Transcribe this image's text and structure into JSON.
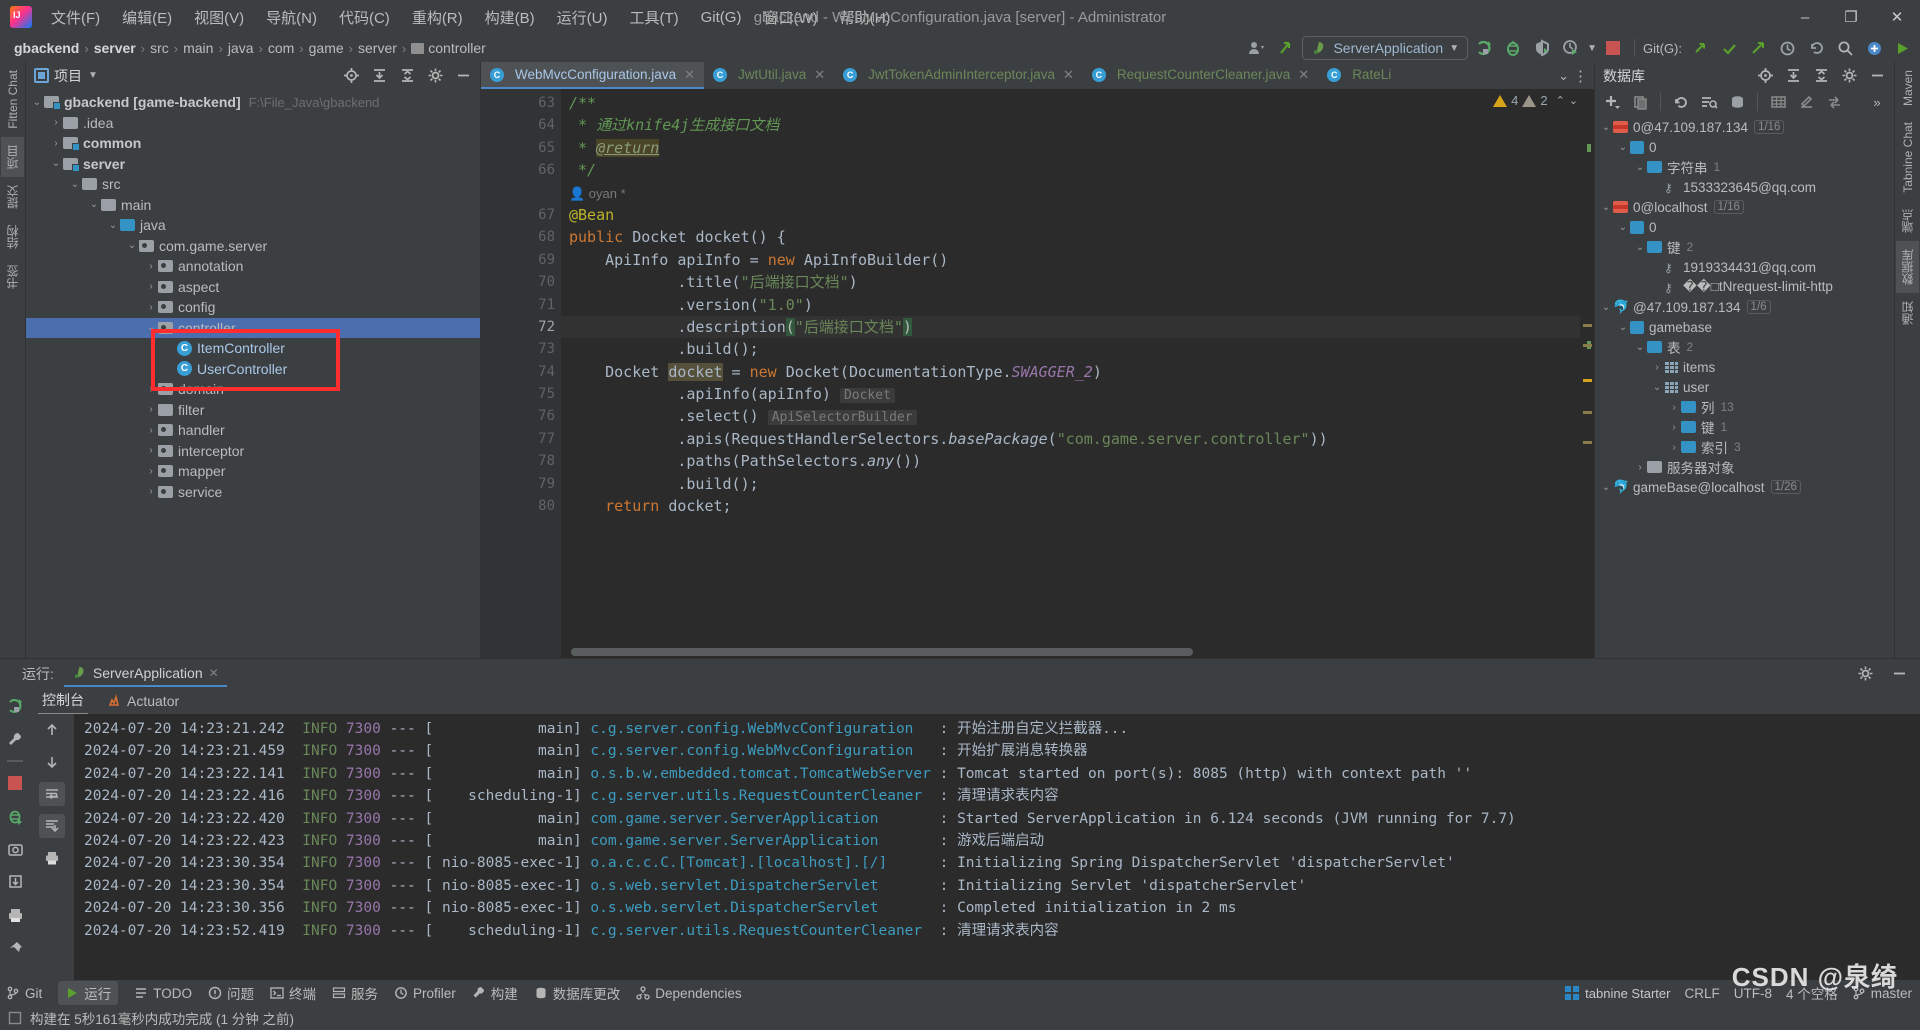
{
  "window": {
    "title": "gbackend - WebMvcConfiguration.java [server] - Administrator",
    "minimize": "–",
    "maximize": "❐",
    "close": "✕"
  },
  "menubar": {
    "items": [
      {
        "label": "文件(F)",
        "name": "menu-file"
      },
      {
        "label": "编辑(E)",
        "name": "menu-edit"
      },
      {
        "label": "视图(V)",
        "name": "menu-view"
      },
      {
        "label": "导航(N)",
        "name": "menu-navigate"
      },
      {
        "label": "代码(C)",
        "name": "menu-code"
      },
      {
        "label": "重构(R)",
        "name": "menu-refactor"
      },
      {
        "label": "构建(B)",
        "name": "menu-build"
      },
      {
        "label": "运行(U)",
        "name": "menu-run"
      },
      {
        "label": "工具(T)",
        "name": "menu-tools"
      },
      {
        "label": "Git(G)",
        "name": "menu-git"
      },
      {
        "label": "窗口(W)",
        "name": "menu-window"
      },
      {
        "label": "帮助(H)",
        "name": "menu-help"
      }
    ]
  },
  "navbar": {
    "breadcrumbs": [
      {
        "label": "gbackend",
        "bold": true
      },
      {
        "label": "server",
        "bold": true
      },
      {
        "label": "src",
        "bold": false
      },
      {
        "label": "main",
        "bold": false
      },
      {
        "label": "java",
        "bold": false
      },
      {
        "label": "com",
        "bold": false
      },
      {
        "label": "game",
        "bold": false
      },
      {
        "label": "server",
        "bold": false
      },
      {
        "label": "controller",
        "bold": false,
        "icon": "folder-icon"
      }
    ],
    "run_config": "ServerApplication",
    "git_label": "Git(G):",
    "icons": {
      "profile": "profile-icon",
      "update": "update-project-icon",
      "run": "run-icon",
      "debug": "debug-icon",
      "coverage": "run-with-coverage-icon",
      "profiler": "profiler-icon",
      "stop": "stop-icon",
      "commit": "commit-icon",
      "push": "push-icon",
      "update_git": "update-icon",
      "history": "history-icon",
      "rollback": "rollback-icon",
      "search": "search-icon",
      "plugin": "plugin-icon",
      "settings": "settings-icon"
    }
  },
  "project_panel": {
    "title": "项目",
    "header_icons": [
      "locate-icon",
      "expand-all-icon",
      "collapse-all-icon",
      "gear-icon",
      "hide-icon"
    ],
    "tree": [
      {
        "label": "gbackend [game-backend]",
        "suffix": "F:\\File_Java\\gbackend",
        "depth": 0,
        "arrow": "v",
        "icon": "module-folder",
        "bold": true
      },
      {
        "label": ".idea",
        "depth": 1,
        "arrow": ">",
        "icon": "folder",
        "bold": false
      },
      {
        "label": "common",
        "depth": 1,
        "arrow": ">",
        "icon": "module-folder",
        "bold": true
      },
      {
        "label": "server",
        "depth": 1,
        "arrow": "v",
        "icon": "module-folder",
        "bold": true
      },
      {
        "label": "src",
        "depth": 2,
        "arrow": "v",
        "icon": "folder",
        "bold": false
      },
      {
        "label": "main",
        "depth": 3,
        "arrow": "v",
        "icon": "folder",
        "bold": false
      },
      {
        "label": "java",
        "depth": 4,
        "arrow": "v",
        "icon": "source-folder",
        "bold": false
      },
      {
        "label": "com.game.server",
        "depth": 5,
        "arrow": "v",
        "icon": "package",
        "bold": false
      },
      {
        "label": "annotation",
        "depth": 6,
        "arrow": ">",
        "icon": "package",
        "bold": false
      },
      {
        "label": "aspect",
        "depth": 6,
        "arrow": ">",
        "icon": "package",
        "bold": false
      },
      {
        "label": "config",
        "depth": 6,
        "arrow": ">",
        "icon": "package",
        "bold": false
      },
      {
        "label": "controller",
        "depth": 6,
        "arrow": "v",
        "icon": "package",
        "bold": false,
        "selected": true
      },
      {
        "label": "ItemController",
        "depth": 7,
        "arrow": "",
        "icon": "class",
        "bold": false
      },
      {
        "label": "UserController",
        "depth": 7,
        "arrow": "",
        "icon": "class",
        "bold": false
      },
      {
        "label": "domain",
        "depth": 6,
        "arrow": ">",
        "icon": "package",
        "bold": false
      },
      {
        "label": "filter",
        "depth": 6,
        "arrow": ">",
        "icon": "folder",
        "bold": false
      },
      {
        "label": "handler",
        "depth": 6,
        "arrow": ">",
        "icon": "package",
        "bold": false
      },
      {
        "label": "interceptor",
        "depth": 6,
        "arrow": ">",
        "icon": "package",
        "bold": false
      },
      {
        "label": "mapper",
        "depth": 6,
        "arrow": ">",
        "icon": "package",
        "bold": false
      },
      {
        "label": "service",
        "depth": 6,
        "arrow": ">",
        "icon": "package",
        "bold": false
      }
    ]
  },
  "editor": {
    "tabs": [
      {
        "label": "WebMvcConfiguration.java",
        "active": true,
        "closable": true
      },
      {
        "label": "JwtUtil.java",
        "active": false,
        "closable": true
      },
      {
        "label": "JwtTokenAdminInterceptor.java",
        "active": false,
        "closable": true
      },
      {
        "label": "RequestCounterCleaner.java",
        "active": false,
        "closable": true
      },
      {
        "label": "RateLi",
        "active": false,
        "closable": false
      }
    ],
    "inspection": {
      "warnings": "4",
      "weak_warnings": "2"
    },
    "lines": [
      {
        "num": "63",
        "fold": "start"
      },
      {
        "num": "64"
      },
      {
        "num": "65"
      },
      {
        "num": "66",
        "fold": "end"
      },
      {
        "num": ""
      },
      {
        "num": "67",
        "gutter_icons": "bean-icon"
      },
      {
        "num": "68",
        "fold": "start"
      },
      {
        "num": "69"
      },
      {
        "num": "70"
      },
      {
        "num": "71"
      },
      {
        "num": "72",
        "current": true,
        "bulb": true
      },
      {
        "num": "73"
      },
      {
        "num": "74"
      },
      {
        "num": "75"
      },
      {
        "num": "76"
      },
      {
        "num": "77"
      },
      {
        "num": "78"
      },
      {
        "num": "79"
      },
      {
        "num": "80"
      }
    ],
    "author_hint": "oyan *",
    "inlay_hints": [
      "Docket",
      "ApiSelectorBuilder"
    ],
    "code_text": {
      "l63": "/**",
      "l64": " * 通过knife4j生成接口文档",
      "l65_pre": " * ",
      "l65_tag": "@return",
      "l67": "@Bean",
      "l68": "public Docket docket() {",
      "l69": "    ApiInfo apiInfo = new ApiInfoBuilder()",
      "l70": "            .title(\"后端接口文档\")",
      "l71": "            .version(\"1.0\")",
      "l72": "            .description(\"后端接口文档\")",
      "l73": "            .build();",
      "l74": "    Docket docket = new Docket(DocumentationType.SWAGGER_2)",
      "l75": "            .apiInfo(apiInfo)",
      "l76": "            .select()",
      "l77": "            .apis(RequestHandlerSelectors.basePackage(\"com.game.server.controller\"))",
      "l78": "            .paths(PathSelectors.any())",
      "l79": "            .build();",
      "l80": "    return docket;"
    }
  },
  "db_panel": {
    "title": "数据库",
    "header_icons": [
      "locate-icon",
      "expand-all-icon",
      "collapse-all-icon",
      "gear-icon",
      "hide-icon"
    ],
    "toolbar_icons": [
      "add-icon",
      "copy-icon",
      "refresh-icon",
      "run-query-icon",
      "db-icon",
      "table-icon",
      "edit-icon",
      "sync-icon",
      "more-icon"
    ],
    "tree": [
      {
        "label": "0@47.109.187.134",
        "badge": "1/16",
        "depth": 0,
        "arrow": "v",
        "icon": "redis"
      },
      {
        "label": "0",
        "depth": 1,
        "arrow": "v",
        "icon": "db"
      },
      {
        "label": "字符串",
        "count": "1",
        "depth": 2,
        "arrow": "v",
        "icon": "folder"
      },
      {
        "label": "1533323645@qq.com",
        "depth": 3,
        "arrow": "",
        "icon": "key-list"
      },
      {
        "label": "0@localhost",
        "badge": "1/16",
        "depth": 0,
        "arrow": "v",
        "icon": "redis"
      },
      {
        "label": "0",
        "depth": 1,
        "arrow": "v",
        "icon": "db"
      },
      {
        "label": "键",
        "count": "2",
        "depth": 2,
        "arrow": "v",
        "icon": "folder"
      },
      {
        "label": "1919334431@qq.com",
        "depth": 3,
        "arrow": "",
        "icon": "key"
      },
      {
        "label": "��□tNrequest-limit-http",
        "depth": 3,
        "arrow": "",
        "icon": "key"
      },
      {
        "label": "@47.109.187.134",
        "badge": "1/6",
        "depth": 0,
        "arrow": "v",
        "icon": "mysql"
      },
      {
        "label": "gamebase",
        "depth": 1,
        "arrow": "v",
        "icon": "schema"
      },
      {
        "label": "表",
        "count": "2",
        "depth": 2,
        "arrow": "v",
        "icon": "folder"
      },
      {
        "label": "items",
        "depth": 3,
        "arrow": ">",
        "icon": "table"
      },
      {
        "label": "user",
        "depth": 3,
        "arrow": "v",
        "icon": "table"
      },
      {
        "label": "列",
        "count": "13",
        "depth": 4,
        "arrow": ">",
        "icon": "folder"
      },
      {
        "label": "键",
        "count": "1",
        "depth": 4,
        "arrow": ">",
        "icon": "folder"
      },
      {
        "label": "索引",
        "count": "3",
        "depth": 4,
        "arrow": ">",
        "icon": "folder"
      },
      {
        "label": "服务器对象",
        "depth": 2,
        "arrow": ">",
        "icon": "server-objects"
      },
      {
        "label": "gameBase@localhost",
        "badge": "1/26",
        "depth": 0,
        "arrow": "v",
        "icon": "mysql"
      }
    ]
  },
  "right_tool_tabs": [
    {
      "label": "Maven",
      "name": "tool-tab-maven",
      "active": false
    },
    {
      "label": "Tabnine Chat",
      "name": "tool-tab-tabnine-chat",
      "active": false
    },
    {
      "label": "端点",
      "name": "tool-tab-endpoints",
      "active": false
    },
    {
      "label": "数据库",
      "name": "tool-tab-database",
      "active": true
    },
    {
      "label": "通知",
      "name": "tool-tab-notifications",
      "active": false
    }
  ],
  "left_tool_tabs": [
    {
      "label": "Fitten Chat",
      "name": "tool-tab-fitten-chat",
      "active": false
    },
    {
      "label": "项目",
      "name": "tool-tab-project",
      "active": true
    },
    {
      "label": "提交",
      "name": "tool-tab-commit",
      "active": false
    },
    {
      "label": "结构",
      "name": "tool-tab-structure",
      "active": false
    },
    {
      "label": "书签",
      "name": "tool-tab-bookmarks",
      "active": false
    }
  ],
  "run_panel": {
    "label": "运行:",
    "tab": "ServerApplication",
    "subtabs": [
      {
        "label": "控制台",
        "active": true
      },
      {
        "label": "Actuator",
        "active": false
      }
    ],
    "side_icons": [
      "rerun-icon",
      "wrench-icon",
      "stop-icon",
      "debug-icon",
      "camera-icon",
      "export-icon",
      "print-icon",
      "pin-icon"
    ],
    "nav_icons": [
      "scroll-up-icon",
      "scroll-down-icon",
      "soft-wrap-icon",
      "scroll-to-end-icon",
      "print-icon"
    ],
    "header_icons": [
      "settings-icon",
      "hide-icon"
    ],
    "logs": [
      {
        "date": "2024-07-20 14:23:21.242",
        "level": "INFO",
        "pid": "7300",
        "thread": "main",
        "cls": "c.g.server.config.WebMvcConfiguration",
        "msg": "开始注册自定义拦截器..."
      },
      {
        "date": "2024-07-20 14:23:21.459",
        "level": "INFO",
        "pid": "7300",
        "thread": "main",
        "cls": "c.g.server.config.WebMvcConfiguration",
        "msg": "开始扩展消息转换器"
      },
      {
        "date": "2024-07-20 14:23:22.141",
        "level": "INFO",
        "pid": "7300",
        "thread": "main",
        "cls": "o.s.b.w.embedded.tomcat.TomcatWebServer",
        "msg": "Tomcat started on port(s): 8085 (http) with context path ''"
      },
      {
        "date": "2024-07-20 14:23:22.416",
        "level": "INFO",
        "pid": "7300",
        "thread": "scheduling-1",
        "cls": "c.g.server.utils.RequestCounterCleaner",
        "msg": "清理请求表内容"
      },
      {
        "date": "2024-07-20 14:23:22.420",
        "level": "INFO",
        "pid": "7300",
        "thread": "main",
        "cls": "com.game.server.ServerApplication",
        "msg": "Started ServerApplication in 6.124 seconds (JVM running for 7.7)"
      },
      {
        "date": "2024-07-20 14:23:22.423",
        "level": "INFO",
        "pid": "7300",
        "thread": "main",
        "cls": "com.game.server.ServerApplication",
        "msg": "游戏后端启动"
      },
      {
        "date": "2024-07-20 14:23:30.354",
        "level": "INFO",
        "pid": "7300",
        "thread": "nio-8085-exec-1",
        "cls": "o.a.c.c.C.[Tomcat].[localhost].[/]",
        "msg": "Initializing Spring DispatcherServlet 'dispatcherServlet'"
      },
      {
        "date": "2024-07-20 14:23:30.354",
        "level": "INFO",
        "pid": "7300",
        "thread": "nio-8085-exec-1",
        "cls": "o.s.web.servlet.DispatcherServlet",
        "msg": "Initializing Servlet 'dispatcherServlet'"
      },
      {
        "date": "2024-07-20 14:23:30.356",
        "level": "INFO",
        "pid": "7300",
        "thread": "nio-8085-exec-1",
        "cls": "o.s.web.servlet.DispatcherServlet",
        "msg": "Completed initialization in 2 ms"
      },
      {
        "date": "2024-07-20 14:23:52.419",
        "level": "INFO",
        "pid": "7300",
        "thread": "scheduling-1",
        "cls": "c.g.server.utils.RequestCounterCleaner",
        "msg": "清理请求表内容"
      }
    ]
  },
  "statusbar": {
    "items": [
      {
        "label": "Git",
        "icon": "git-icon"
      },
      {
        "label": "运行",
        "icon": "run-icon",
        "active": true
      },
      {
        "label": "TODO",
        "icon": "todo-icon"
      },
      {
        "label": "问题",
        "icon": "problems-icon"
      },
      {
        "label": "终端",
        "icon": "terminal-icon"
      },
      {
        "label": "服务",
        "icon": "services-icon"
      },
      {
        "label": "Profiler",
        "icon": "profiler-icon"
      },
      {
        "label": "构建",
        "icon": "build-icon"
      },
      {
        "label": "数据库更改",
        "icon": "db-changes-icon"
      },
      {
        "label": "Dependencies",
        "icon": "dependencies-icon"
      }
    ],
    "build_message": "构建在 5秒161毫秒内成功完成 (1 分钟 之前)",
    "tabnine": "tabnine Starter",
    "line_sep": "CRLF",
    "encoding": "UTF-8",
    "indent": "4 个空格",
    "branch": "master"
  },
  "watermark": "CSDN @泉绮"
}
